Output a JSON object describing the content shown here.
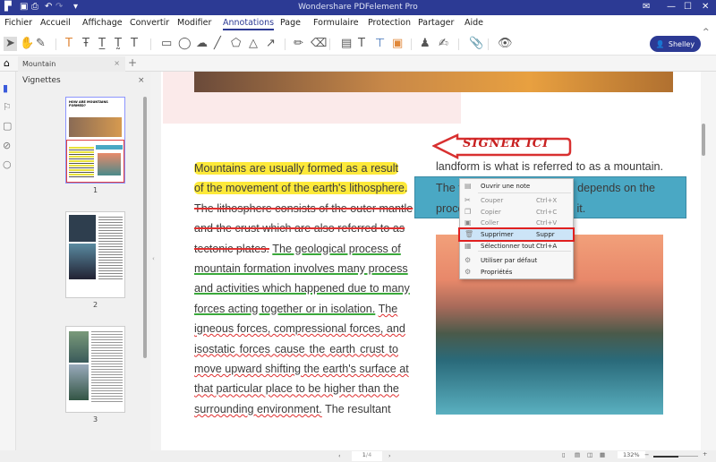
{
  "app": {
    "title": "Wondershare PDFelement Pro"
  },
  "menu": [
    "Fichier",
    "Accueil",
    "Affichage",
    "Convertir",
    "Modifier",
    "Annotations",
    "Page",
    "Formulaire",
    "Protection",
    "Partager",
    "Aide"
  ],
  "active_menu": "Annotations",
  "user": {
    "name": "Shelley"
  },
  "tab": {
    "label": "Mountain"
  },
  "panel": {
    "title": "Vignettes",
    "thumbnails": [
      "1",
      "2",
      "3"
    ],
    "thumb1_title": "HOW ARE MOUNTAINS FORMED?"
  },
  "document": {
    "left_lines": [
      [
        {
          "t": "Mountains are usually formed as a result",
          "s": "hl"
        }
      ],
      [
        {
          "t": "of the movement of the earth's lithosphere.",
          "s": "hl"
        }
      ],
      [
        {
          "t": "The lithosphere consists of the outer mantle",
          "s": "strike"
        }
      ],
      [
        {
          "t": "and the crust which are also referred to as",
          "s": "strike"
        }
      ],
      [
        {
          "t": "tectonic plates.",
          "s": "strike"
        },
        {
          "t": " ",
          "s": ""
        },
        {
          "t": "The geological process of",
          "s": "green"
        }
      ],
      [
        {
          "t": "mountain formation involves many process",
          "s": "green"
        }
      ],
      [
        {
          "t": "and activities which happened due to many",
          "s": "green"
        }
      ],
      [
        {
          "t": "forces acting together or in isolation.",
          "s": "green"
        },
        {
          "t": " ",
          "s": ""
        },
        {
          "t": "The",
          "s": "red"
        }
      ],
      [
        {
          "t": "igneous forces, compressional forces, and",
          "s": "red"
        }
      ],
      [
        {
          "t": "isostatic forces cause the earth crust to",
          "s": "red"
        }
      ],
      [
        {
          "t": "move upward shifting the earth's surface at",
          "s": "red"
        }
      ],
      [
        {
          "t": "that particular place to be higher than the",
          "s": "red"
        }
      ],
      [
        {
          "t": "surrounding environment.",
          "s": "red"
        },
        {
          "t": " The resultant",
          "s": ""
        }
      ]
    ],
    "stamp": "SIGNER ICI",
    "right_line1": "landform is what is referred to as a mountain.",
    "right_line2": "The t                                ed depends on the",
    "right_line3": "proce                                 n it."
  },
  "context_menu": [
    {
      "label": "Ouvrir une note",
      "shortcut": "",
      "icon": "note-icon",
      "disabled": false
    },
    {
      "label": "Couper",
      "shortcut": "Ctrl+X",
      "icon": "scissors-icon",
      "disabled": true
    },
    {
      "label": "Copier",
      "shortcut": "Ctrl+C",
      "icon": "copy-icon",
      "disabled": true
    },
    {
      "label": "Coller",
      "shortcut": "Ctrl+V",
      "icon": "paste-icon",
      "disabled": true
    },
    {
      "label": "Supprimer",
      "shortcut": "Suppr",
      "icon": "trash-icon",
      "disabled": false,
      "highlighted": true
    },
    {
      "label": "Sélectionner tout",
      "shortcut": "Ctrl+A",
      "icon": "select-all-icon",
      "disabled": false
    },
    {
      "label": "Utiliser par défaut",
      "shortcut": "",
      "icon": "gear-icon",
      "disabled": false
    },
    {
      "label": "Propriétés",
      "shortcut": "",
      "icon": "gear-icon",
      "disabled": false
    }
  ],
  "status": {
    "page_input": "1",
    "page_total": "/4",
    "zoom": "132%",
    "zoom_level": 0.55
  },
  "colors": {
    "titlebar": "#2c3a94",
    "highlight": "#fde93a",
    "strike": "#e03030",
    "underline": "#3aa83a",
    "selection_box": "#4aa8c4",
    "context_outline": "#e02020"
  }
}
